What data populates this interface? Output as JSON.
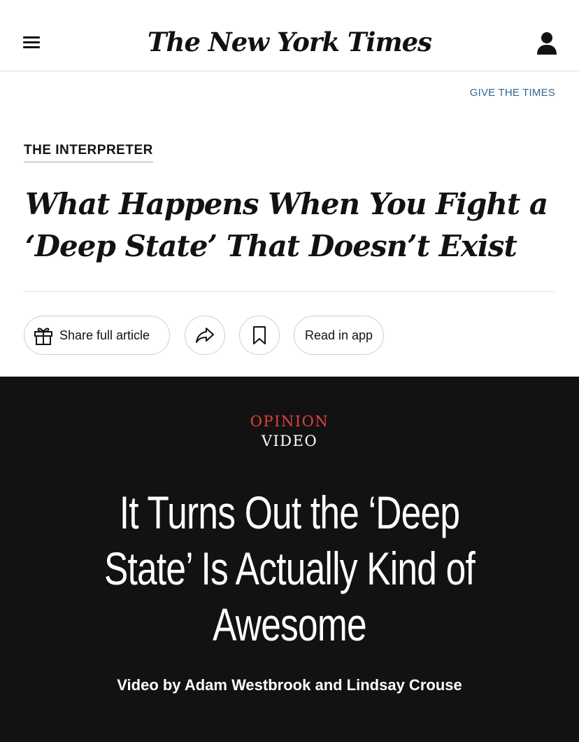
{
  "header": {
    "logo": "The New York Times",
    "menu_icon": "hamburger-menu-icon",
    "account_icon": "user-account-icon"
  },
  "promo": {
    "give_link": "GIVE THE TIMES"
  },
  "article": {
    "kicker": "THE INTERPRETER",
    "headline": "What Happens When You Fight a ‘Deep State’ That Doesn’t Exist"
  },
  "actions": {
    "share_full_article": "Share full article",
    "share_icon": "share-arrow-icon",
    "save_icon": "bookmark-icon",
    "gift_icon": "gift-icon",
    "read_in_app": "Read in app"
  },
  "video": {
    "section": "OPINION",
    "label": "VIDEO",
    "title": "It Turns Out the ‘Deep State’ Is Actually Kind of Awesome",
    "byline": "Video by Adam Westbrook and Lindsay Crouse"
  },
  "colors": {
    "link": "#326891",
    "opinion_red": "#e0423a",
    "video_bg": "#121212"
  }
}
